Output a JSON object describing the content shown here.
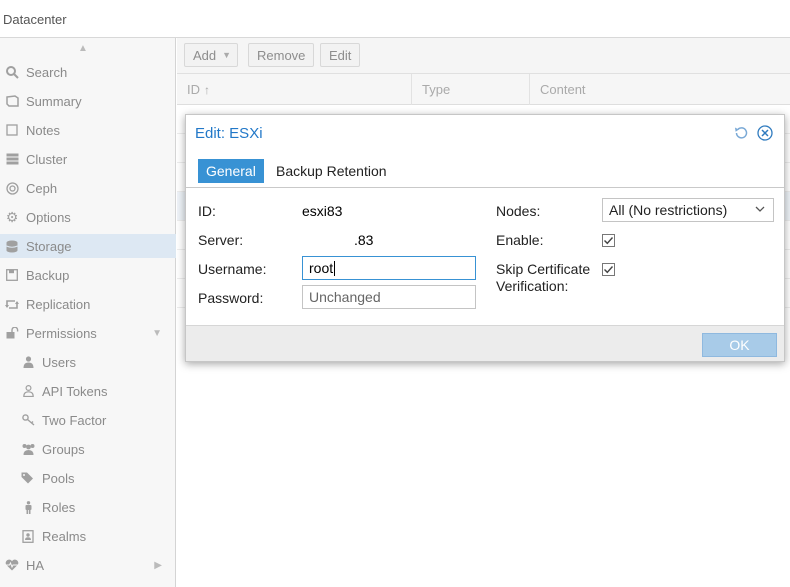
{
  "header": {
    "title": "Datacenter"
  },
  "sidebar": {
    "items": [
      {
        "label": "Search",
        "icon": "search-icon"
      },
      {
        "label": "Summary",
        "icon": "book-icon"
      },
      {
        "label": "Notes",
        "icon": "note-icon"
      },
      {
        "label": "Cluster",
        "icon": "server-icon"
      },
      {
        "label": "Ceph",
        "icon": "ceph-icon"
      },
      {
        "label": "Options",
        "icon": "gear-icon"
      },
      {
        "label": "Storage",
        "icon": "database-icon",
        "selected": true
      },
      {
        "label": "Backup",
        "icon": "floppy-icon"
      },
      {
        "label": "Replication",
        "icon": "retweet-icon"
      },
      {
        "label": "Permissions",
        "icon": "unlock-icon"
      },
      {
        "label": "Users",
        "icon": "user-icon",
        "sub": true
      },
      {
        "label": "API Tokens",
        "icon": "user-outline-icon",
        "sub": true
      },
      {
        "label": "Two Factor",
        "icon": "key-icon",
        "sub": true
      },
      {
        "label": "Groups",
        "icon": "users-icon",
        "sub": true
      },
      {
        "label": "Pools",
        "icon": "tags-icon",
        "sub": true
      },
      {
        "label": "Roles",
        "icon": "male-icon",
        "sub": true
      },
      {
        "label": "Realms",
        "icon": "address-book-icon",
        "sub": true
      },
      {
        "label": "HA",
        "icon": "heartbeat-icon"
      }
    ]
  },
  "toolbar": {
    "add_label": "Add",
    "remove_label": "Remove",
    "edit_label": "Edit"
  },
  "grid": {
    "columns": [
      "ID",
      "Type",
      "Content"
    ]
  },
  "dialog": {
    "title": "Edit: ESXi",
    "tabs": [
      "General",
      "Backup Retention"
    ],
    "fields": {
      "id_label": "ID:",
      "id_value": "esxi83",
      "server_label": "Server:",
      "server_value": ".83",
      "username_label": "Username:",
      "username_value": "root",
      "password_label": "Password:",
      "password_value": "Unchanged",
      "nodes_label": "Nodes:",
      "nodes_value": "All (No restrictions)",
      "enable_label": "Enable:",
      "enable_checked": true,
      "skipcert_label_1": "Skip Certificate",
      "skipcert_label_2": "Verification:",
      "skipcert_checked": true
    },
    "ok_label": "OK"
  },
  "colors": {
    "accent": "#3892d4",
    "title": "#2278c8",
    "ok_disabled": "#a8cbe8",
    "selected_row": "#dde8f3"
  }
}
